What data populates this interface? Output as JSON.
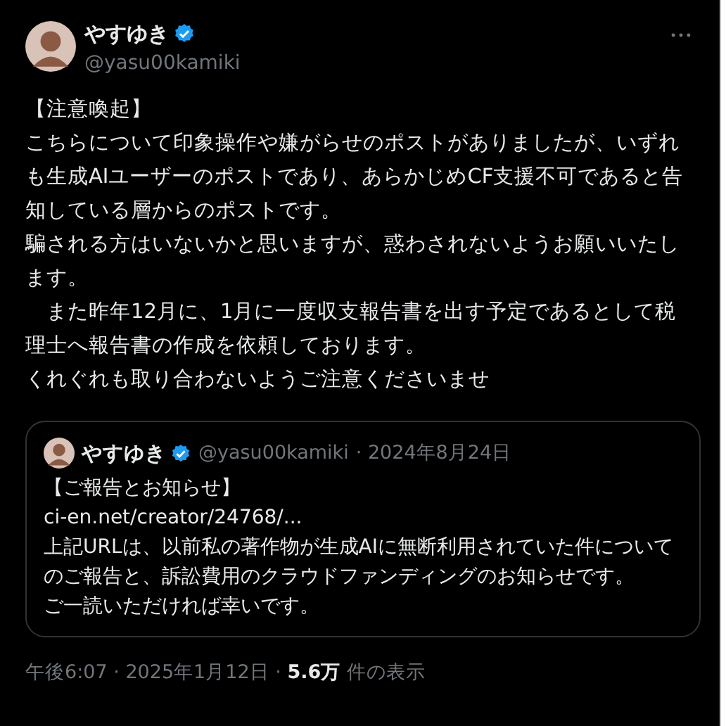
{
  "post": {
    "author": {
      "name": "やすゆき",
      "handle": "@yasu00kamiki",
      "verified": true
    },
    "body": [
      "【注意喚起】",
      "こちらについて印象操作や嫌がらせのポストがありましたが、いずれも生成AIユーザーのポストであり、あらかじめCF支援不可であると告知している層からのポストです。",
      "騙される方はいないかと思いますが、惑わされないようお願いいたします。",
      "　また昨年12月に、1月に一度収支報告書を出す予定であるとして税理士へ報告書の作成を依頼しております。",
      "くれぐれも取り合わないようご注意くださいませ"
    ],
    "quote": {
      "author": {
        "name": "やすゆき",
        "handle": "@yasu00kamiki",
        "verified": true
      },
      "date": "· 2024年8月24日",
      "body": [
        "【ご報告とお知らせ】",
        "ci-en.net/creator/24768/...",
        "上記URLは、以前私の著作物が生成AIに無断利用されていた件についてのご報告と、訴訟費用のクラウドファンディングのお知らせです。",
        "ご一読いただければ幸いです。"
      ]
    },
    "meta": "午後6:07 · 2025年1月12日 · **5.6万** 件の表示"
  }
}
